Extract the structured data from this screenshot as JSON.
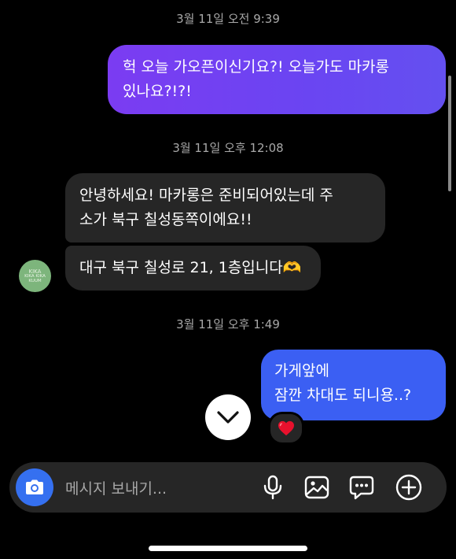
{
  "conversation": {
    "timestamps": [
      "3월 11일 오전 9:39",
      "3월 11일 오후 12:08",
      "3월 11일 오후 1:49"
    ],
    "messages": [
      {
        "from": "me",
        "text": "헉 오늘 가오픈이신기요?! 오늘가도 마카롱\n있나요?!?!"
      },
      {
        "from": "them",
        "text": "안녕하세요! 마카롱은 준비되어있는데 주\n소가 북구 칠성동쪽이에요!!"
      },
      {
        "from": "them",
        "text": "대구 북구 칠성로 21, 1층입니다🫶"
      },
      {
        "from": "me",
        "text": "가게앞에\n잠깐 차대도 되니용..?"
      }
    ],
    "reaction": "heart-emoji",
    "avatar": {
      "top": "KIKA",
      "line1": "KIKA KIKA",
      "line2": "KUUM"
    }
  },
  "composer": {
    "placeholder": "메시지 보내기..."
  },
  "colors": {
    "sent_gradient_start": "#7b3cf2",
    "sent_gradient_end": "#6450f0",
    "sent_blue": "#3b5ff3",
    "received": "#262626",
    "camera": "#3570f0",
    "avatar": "#7db57c"
  }
}
